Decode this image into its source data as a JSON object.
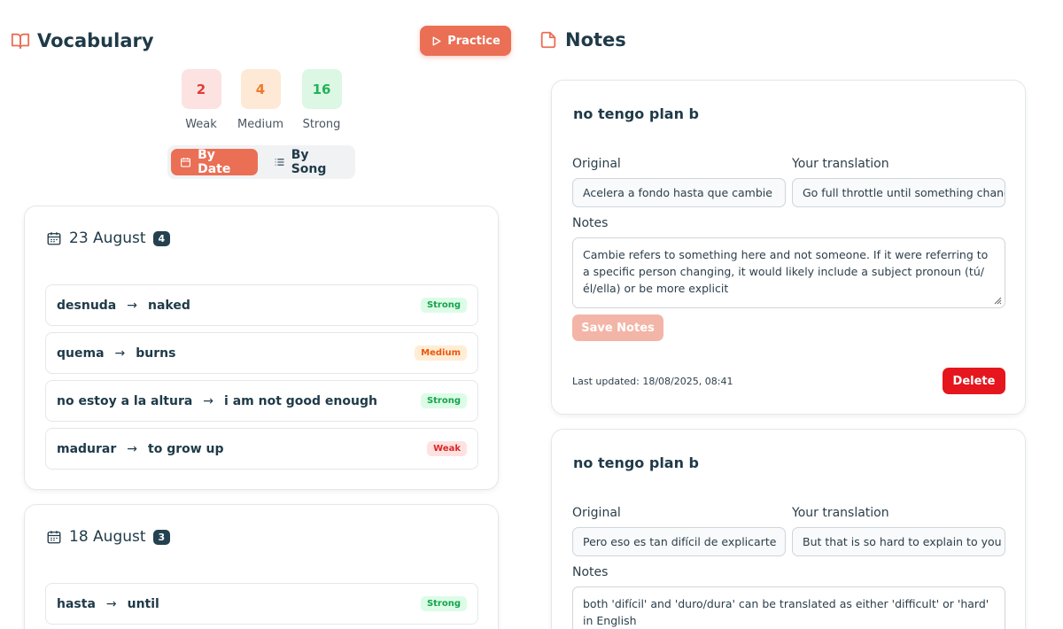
{
  "vocabulary": {
    "title": "Vocabulary",
    "practice_label": "Practice",
    "stats": [
      {
        "value": "2",
        "label": "Weak",
        "bg": "#fde2e2",
        "color": "#e53935"
      },
      {
        "value": "4",
        "label": "Medium",
        "bg": "#fde9d6",
        "color": "#f07a2c"
      },
      {
        "value": "16",
        "label": "Strong",
        "bg": "#dcf7e3",
        "color": "#22b35a"
      }
    ],
    "toggle": {
      "by_date": "By Date",
      "by_song": "By Song"
    },
    "groups": [
      {
        "date": "23 August",
        "count": "4",
        "words": [
          {
            "word": "desnuda",
            "translation": "naked",
            "level": "Strong"
          },
          {
            "word": "quema",
            "translation": "burns",
            "level": "Medium"
          },
          {
            "word": "no estoy a la altura",
            "translation": "i am not good enough",
            "level": "Strong"
          },
          {
            "word": "madurar",
            "translation": "to grow up",
            "level": "Weak"
          }
        ]
      },
      {
        "date": "18 August",
        "count": "3",
        "words": [
          {
            "word": "hasta",
            "translation": "until",
            "level": "Strong"
          }
        ]
      }
    ]
  },
  "notes": {
    "title": "Notes",
    "labels": {
      "original": "Original",
      "translation": "Your translation",
      "notes": "Notes",
      "save": "Save Notes",
      "delete": "Delete"
    },
    "cards": [
      {
        "song": "no tengo plan b",
        "original": "Acelera a fondo hasta que cambie",
        "translation": "Go full throttle until something changes",
        "notes": "Cambie refers to something here and not someone. If it were referring to a specific person changing, it would likely include a subject pronoun (tú/él/ella) or be more explicit",
        "last_updated": "Last updated: 18/08/2025, 08:41"
      },
      {
        "song": "no tengo plan b",
        "original": "Pero eso es tan difícil de explicarte",
        "translation": "But that is so hard to explain to you",
        "notes": "both 'difícil' and 'duro/dura' can be translated as either 'difficult' or 'hard' in English"
      }
    ]
  },
  "colors": {
    "accent": "#ea6f55",
    "dark": "#24414f",
    "delete": "#e5161d"
  }
}
